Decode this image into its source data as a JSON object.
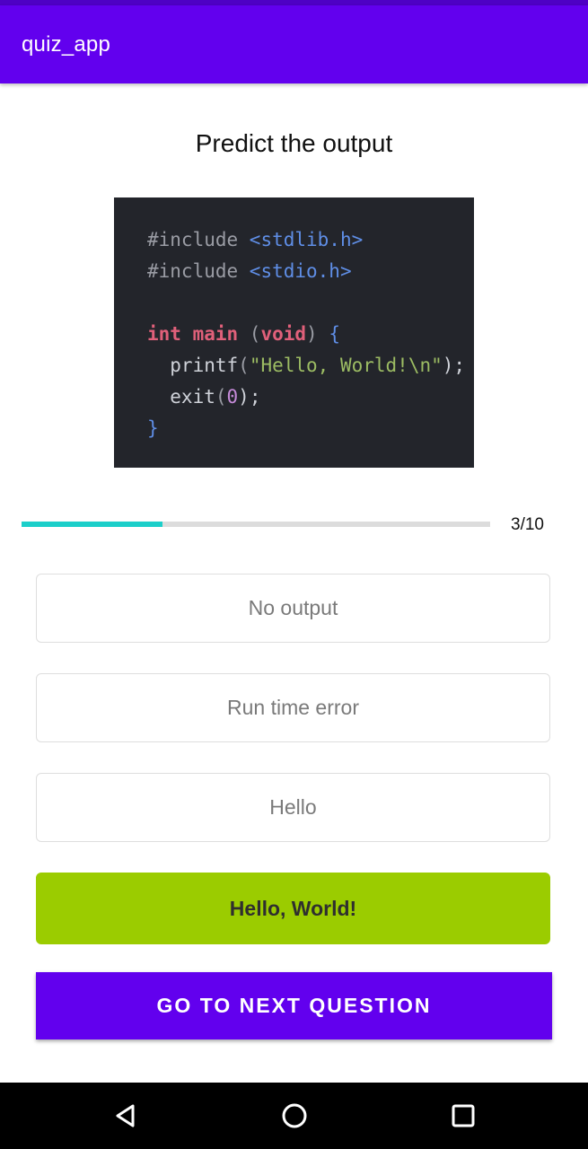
{
  "app_bar": {
    "title": "quiz_app",
    "color": "#6200ee"
  },
  "question": {
    "text": "Predict the output",
    "code_image": {
      "lines": [
        [
          [
            "#include ",
            "gray"
          ],
          [
            "<stdlib.h>",
            "blue"
          ]
        ],
        [
          [
            "#include ",
            "gray"
          ],
          [
            "<stdio.h>",
            "blue"
          ]
        ],
        [],
        [
          [
            "int ",
            "pink"
          ],
          [
            "main ",
            "pink"
          ],
          [
            "(",
            "gray"
          ],
          [
            "void",
            "pink"
          ],
          [
            ") ",
            "gray"
          ],
          [
            "{",
            "blue"
          ]
        ],
        [
          [
            "  printf",
            "white"
          ],
          [
            "(",
            "gray"
          ],
          [
            "\"Hello, World!\\n\"",
            "green"
          ],
          [
            ");",
            "white"
          ]
        ],
        [
          [
            "  exit",
            "white"
          ],
          [
            "(",
            "gray"
          ],
          [
            "0",
            "purple"
          ],
          [
            ");",
            "white"
          ]
        ],
        [
          [
            "}",
            "blue"
          ]
        ]
      ]
    }
  },
  "progress": {
    "current": 3,
    "total": 10,
    "fraction": 0.3,
    "label": "3/10",
    "color": "#1ccfca"
  },
  "options": [
    {
      "label": "No output",
      "selected": false
    },
    {
      "label": "Run time error",
      "selected": false
    },
    {
      "label": "Hello",
      "selected": false
    },
    {
      "label": "Hello, World!",
      "selected": true,
      "color": "#9bcc00"
    }
  ],
  "next_button": {
    "label": "GO TO NEXT QUESTION"
  },
  "nav_bar": {
    "icons": [
      "back-icon",
      "home-icon",
      "recents-icon"
    ]
  }
}
